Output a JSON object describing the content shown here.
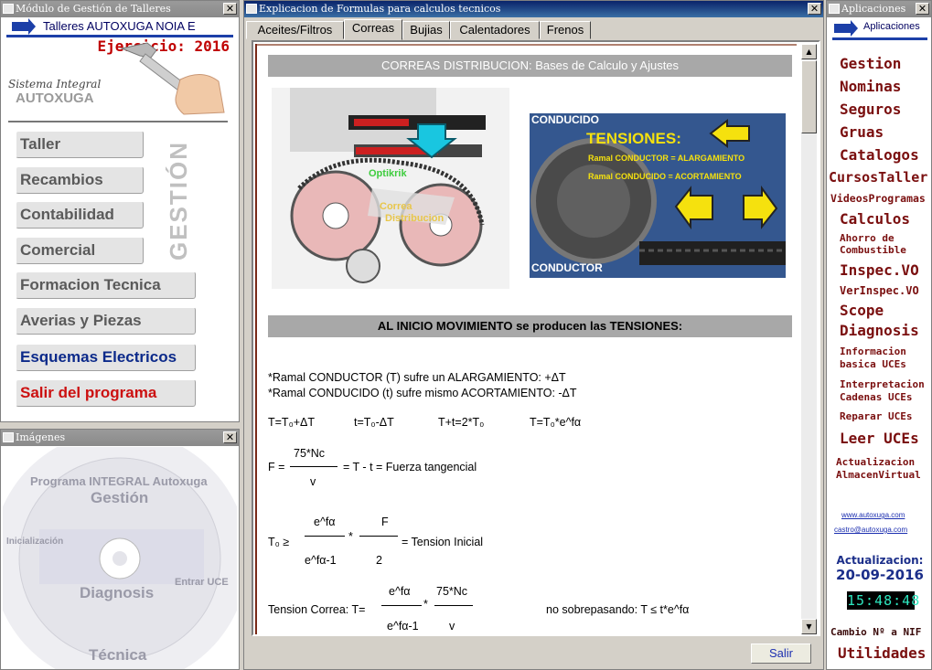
{
  "left_window": {
    "title": "Módulo de Gestión de Talleres",
    "close": "✕",
    "brand": "Talleres AUTOXUGA NOIA E",
    "ejercicio": "Ejercicio: 2016",
    "sistema": "Sistema Integral",
    "autoxuga": "AUTOXUGA",
    "vertical_label": "GESTIÓN",
    "menu": [
      {
        "label": "Taller",
        "color": "#5a5a5a"
      },
      {
        "label": "Recambios",
        "color": "#5a5a5a"
      },
      {
        "label": "Contabilidad",
        "color": "#5a5a5a"
      },
      {
        "label": "Comercial",
        "color": "#5a5a5a"
      },
      {
        "label": "Formacion Tecnica",
        "color": "#5a5a5a"
      },
      {
        "label": "Averias y Piezas",
        "color": "#5a5a5a"
      },
      {
        "label": "Esquemas Electricos",
        "color": "#0c2a8a"
      },
      {
        "label": "Salir del programa",
        "color": "#cc1010"
      }
    ]
  },
  "images_window": {
    "title": "Imágenes",
    "close": "✕",
    "cd_lines": [
      "Programa INTEGRAL Autoxuga",
      "Gestión",
      "Diagnosis",
      "Técnica",
      "Inicialización",
      "Entrar UCE"
    ]
  },
  "center_window": {
    "title": "Explicacion de Formulas para calculos tecnicos",
    "close": "✕",
    "tabs": [
      "Aceites/Filtros",
      "Correas",
      "Bujias",
      "Calentadores",
      "Frenos"
    ],
    "selected_tab": "Correas",
    "section1": "CORREAS DISTRIBUCION: Bases de Calculo y Ajustes",
    "engine_labels": {
      "optikrik": "Optikrik",
      "correa": "Correa",
      "distribucion": "Distribucion"
    },
    "photo_labels": {
      "conducido": "CONDUCIDO",
      "conductor": "CONDUCTOR",
      "tensiones": "TENSIONES:",
      "ramal1": "Ramal CONDUCTOR = ALARGAMIENTO",
      "ramal2": "Ramal CONDUCIDO = ACORTAMIENTO"
    },
    "section2": "AL INICIO MOVIMIENTO se producen las TENSIONES:",
    "line1": "*Ramal CONDUCTOR (T) sufre un ALARGAMIENTO: +ΔT",
    "line2": "*Ramal CONDUCIDO (t) sufre mismo ACORTAMIENTO: -ΔT",
    "eq1": "T=T₀+ΔT",
    "eq2": "t=T₀-ΔT",
    "eq3": "T+t=2*T₀",
    "eq4": "T=T₀*e^fα",
    "f_num": "75*Nc",
    "f_prefix": "F =",
    "f_den": "v",
    "f_rest": "= T - t = Fuerza tangencial",
    "t0_prefix": "T₀ ≥",
    "t0_num1": "e^fα",
    "t0_den1": "e^fα-1",
    "t0_times": "*",
    "t0_num2": "F",
    "t0_den2": "2",
    "t0_rest": "= Tension Inicial",
    "tc_prefix": "Tension Correa: T=",
    "tc_num1": "e^fα",
    "tc_den1": "e^fα-1",
    "tc_times": "*",
    "tc_num2": "75*Nc",
    "tc_den2": "v",
    "tc_rest": "no sobrepasando: T ≤ t*e^fα",
    "salir": "Salir"
  },
  "right_window": {
    "title": "Aplicaciones",
    "close": "✕",
    "header": "Aplicaciones",
    "items": [
      "Gestion",
      "Nominas",
      "Seguros",
      "Gruas",
      "Catalogos",
      "CursosTaller",
      "VideosProgramas",
      "Calculos",
      "Ahorro de",
      "Combustible",
      "Inspec.VO",
      "VerInspec.VO",
      "Scope",
      "Diagnosis",
      "Informacion",
      "basica UCEs",
      "Interpretacion",
      "Cadenas UCEs",
      "Reparar UCEs",
      "Leer UCEs",
      "Actualizacion",
      "AlmacenVirtual"
    ],
    "web": "www.autoxuga.com",
    "email": "castro@autoxuga.com",
    "actualizacion_label": "Actualizacion:",
    "actualizacion_date": "20-09-2016",
    "clock": "15:48:48",
    "cambio": "Cambio Nº a NIF",
    "utilidades": "Utilidades"
  }
}
